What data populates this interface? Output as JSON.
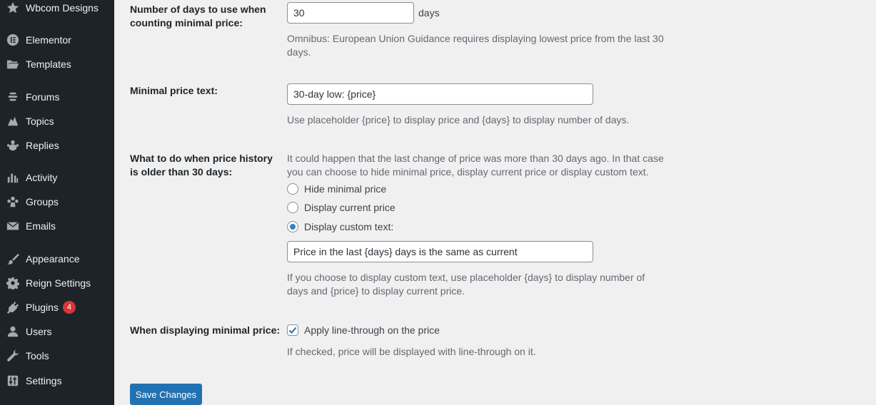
{
  "sidebar": {
    "items": [
      {
        "label": "Wbcom Designs",
        "icon": "star-icon"
      },
      {
        "label": "Elementor",
        "icon": "elementor-icon"
      },
      {
        "label": "Templates",
        "icon": "folder-icon"
      },
      {
        "label": "Forums",
        "icon": "forums-icon"
      },
      {
        "label": "Topics",
        "icon": "topics-icon"
      },
      {
        "label": "Replies",
        "icon": "replies-icon"
      },
      {
        "label": "Activity",
        "icon": "activity-icon"
      },
      {
        "label": "Groups",
        "icon": "groups-icon"
      },
      {
        "label": "Emails",
        "icon": "email-icon"
      },
      {
        "label": "Appearance",
        "icon": "brush-icon"
      },
      {
        "label": "Reign Settings",
        "icon": "gear-icon"
      },
      {
        "label": "Plugins",
        "icon": "plugin-icon",
        "badge": "4"
      },
      {
        "label": "Users",
        "icon": "user-icon"
      },
      {
        "label": "Tools",
        "icon": "wrench-icon"
      },
      {
        "label": "Settings",
        "icon": "settings-icon"
      }
    ]
  },
  "settings": {
    "days": {
      "label": "Number of days to use when counting minimal price:",
      "value": "30",
      "unit": "days",
      "description": "Omnibus: European Union Guidance requires displaying lowest price from the last 30 days."
    },
    "min_price_text": {
      "label": "Minimal price text:",
      "value": "30-day low: {price}",
      "description": "Use placeholder {price} to display price and {days} to display number of days."
    },
    "older_history": {
      "label": "What to do when price history is older than 30 days:",
      "description": "It could happen that the last change of price was more than 30 days ago. In that case you can choose to hide minimal price, display current price or display custom text.",
      "options": [
        "Hide minimal price",
        "Display current price",
        "Display custom text:"
      ],
      "selected": "Display custom text:",
      "custom_text_value": "Price in the last {days} days is the same as current",
      "custom_description": "If you choose to display custom text, use placeholder {days} to display number of days and {price} to display current price."
    },
    "line_through": {
      "label": "When displaying minimal price:",
      "checkbox_label": "Apply line-through on the price",
      "checked": true,
      "description": "If checked, price will be displayed with line-through on it."
    },
    "save_label": "Save Changes"
  },
  "colors": {
    "sidebar_bg": "#1d2327",
    "accent": "#2271b1",
    "badge": "#d63638"
  }
}
